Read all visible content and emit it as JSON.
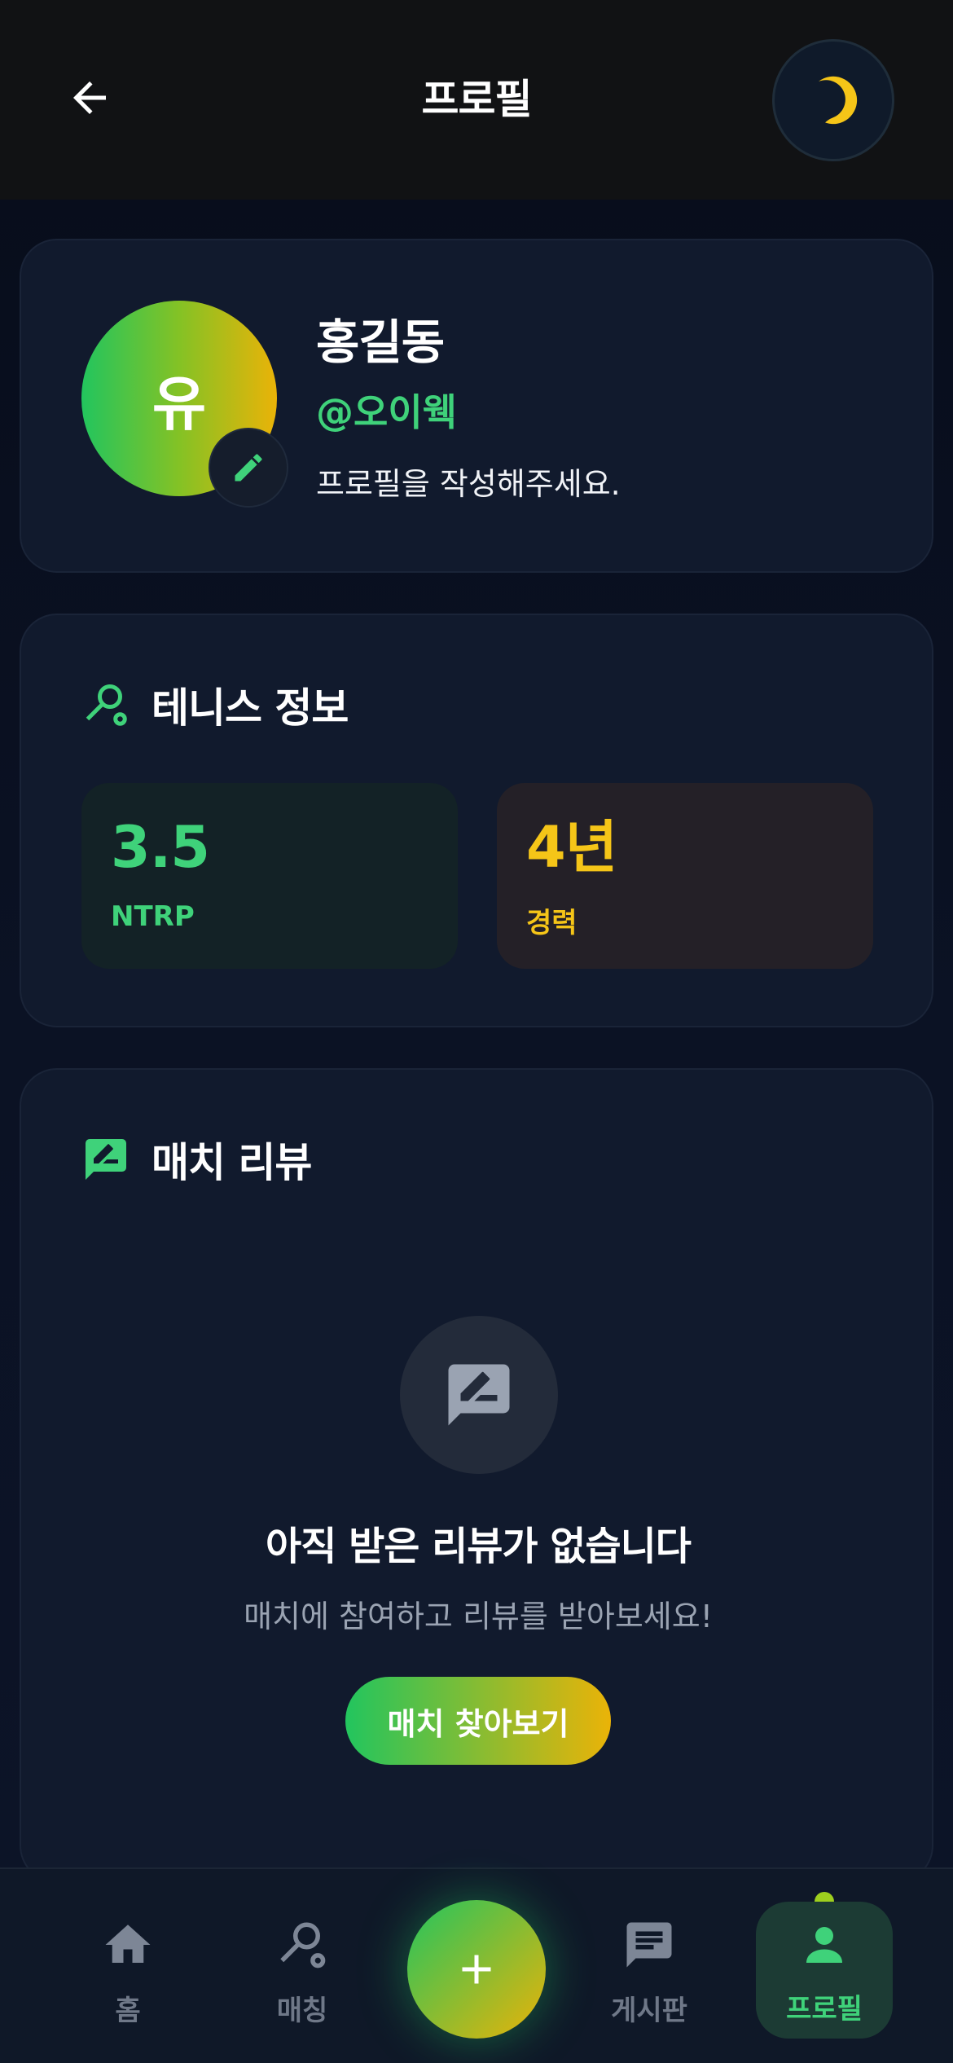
{
  "header": {
    "title": "프로필",
    "back_icon": "arrow-left-icon",
    "theme_icon": "moon-icon"
  },
  "profile": {
    "avatar_text": "유",
    "name": "홍길동",
    "handle": "@오이웩",
    "bio": "프로필을 작성해주세요."
  },
  "tennis": {
    "title": "테니스 정보",
    "stats": [
      {
        "value": "3.5",
        "label": "NTRP"
      },
      {
        "value": "4년",
        "label": "경력"
      }
    ]
  },
  "review": {
    "title": "매치 리뷰",
    "empty_title": "아직 받은 리뷰가 없습니다",
    "empty_sub": "매치에 참여하고 리뷰를 받아보세요!",
    "find_button": "매치 찾아보기"
  },
  "nav": {
    "items": [
      {
        "label": "홈",
        "icon": "home-icon"
      },
      {
        "label": "매칭",
        "icon": "racket-icon"
      },
      {
        "label": "게시판",
        "icon": "chat-icon"
      },
      {
        "label": "프로필",
        "icon": "person-icon"
      }
    ],
    "fab_icon": "plus-icon"
  },
  "colors": {
    "accent_green": "#3fd27a",
    "accent_yellow": "#f5c518",
    "background": "#0a1020"
  }
}
